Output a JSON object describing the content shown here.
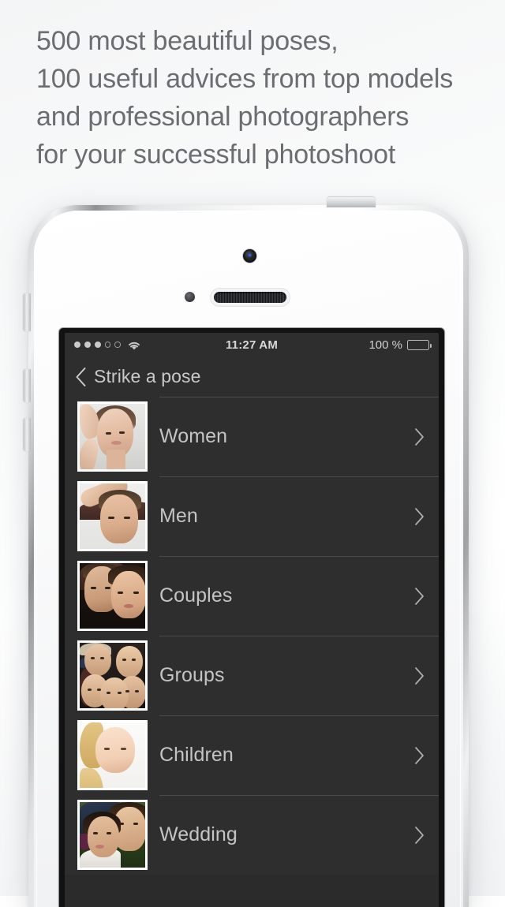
{
  "headline": "500 most beautiful poses,\n100 useful advices from top models\nand professional photographers\nfor your successful photoshoot",
  "colors": {
    "page_bg": "#f7f8f9",
    "headline_text": "#6b6d70",
    "screen_bg": "#2b2b2b",
    "row_bg": "#2e2e2e",
    "row_separator": "#4a4a4a",
    "row_label_text": "#c4c4c4",
    "nav_title_text": "#c9c9c9",
    "status_text": "#d8d8d8",
    "phone_body": "#ffffff"
  },
  "phone": {
    "hardware": {
      "camera": "front-camera",
      "sensor": "proximity-sensor",
      "speaker": "earpiece-speaker",
      "power_button": "power-button",
      "mute_switch": "mute-switch",
      "volume_up": "volume-up-button",
      "volume_down": "volume-down-button"
    }
  },
  "statusbar": {
    "signal_dots_filled": 3,
    "signal_dots_total": 5,
    "wifi": "wifi-icon",
    "time": "11:27 AM",
    "battery_percent": "100 %",
    "battery_level": 100
  },
  "navbar": {
    "back": "back-chevron-icon",
    "title": "Strike a pose"
  },
  "list": {
    "chevron": "chevron-right-icon",
    "rows": [
      {
        "label": "Women",
        "thumb": "woman-portrait-thumbnail"
      },
      {
        "label": "Men",
        "thumb": "man-portrait-thumbnail"
      },
      {
        "label": "Couples",
        "thumb": "couple-portrait-thumbnail"
      },
      {
        "label": "Groups",
        "thumb": "group-portrait-thumbnail"
      },
      {
        "label": "Children",
        "thumb": "child-portrait-thumbnail"
      },
      {
        "label": "Wedding",
        "thumb": "wedding-portrait-thumbnail"
      }
    ]
  }
}
